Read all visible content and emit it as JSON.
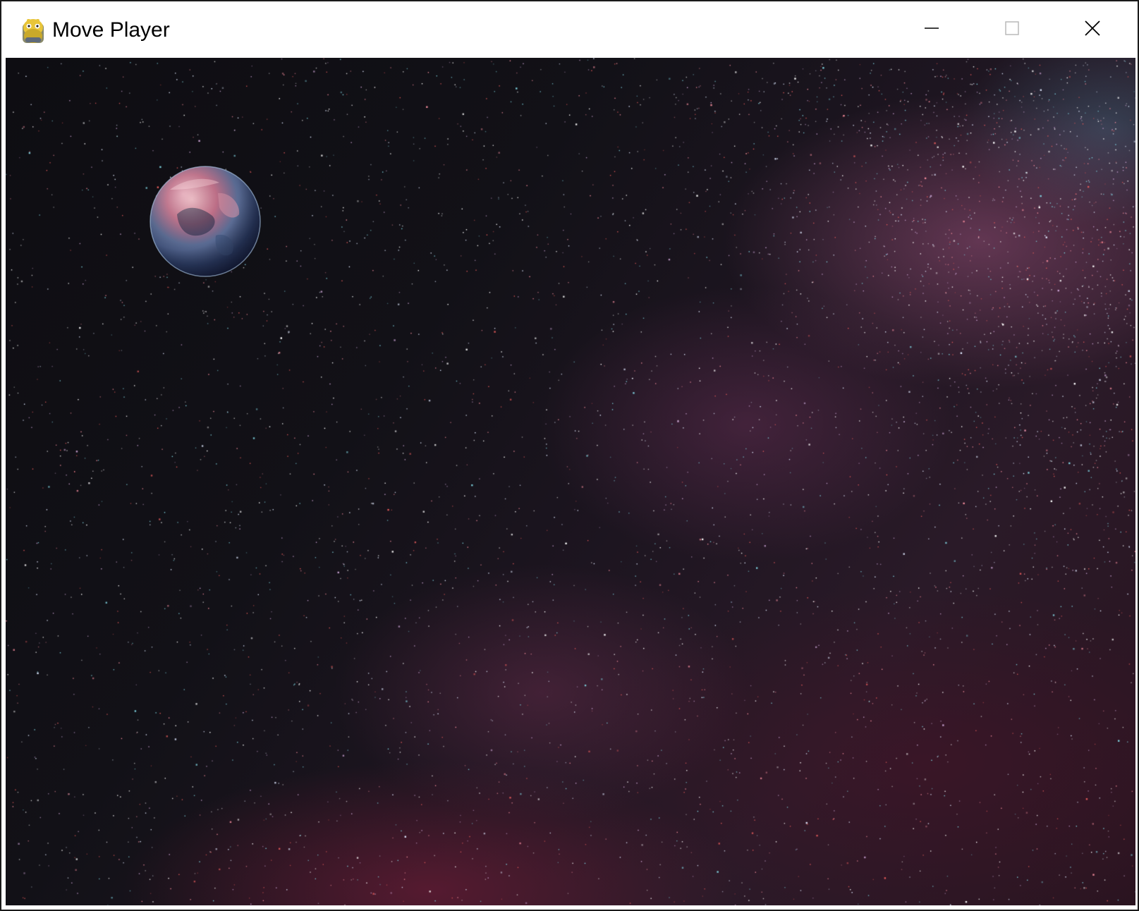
{
  "window": {
    "title": "Move Player"
  },
  "titlebar": {
    "app_icon": "pygame-snake-icon",
    "controls": [
      "minimize-icon",
      "maximize-icon",
      "close-icon"
    ]
  },
  "scene": {
    "background": "starfield-milky-way",
    "player_sprite": "earth-planet-sprite"
  },
  "colors": {
    "titlebar_bg": "#ffffff",
    "space_dark": "#0e0d12",
    "nebula_pink": "#96507a",
    "star_cyan": "#7fd3e0",
    "star_red": "#e05a5a"
  }
}
